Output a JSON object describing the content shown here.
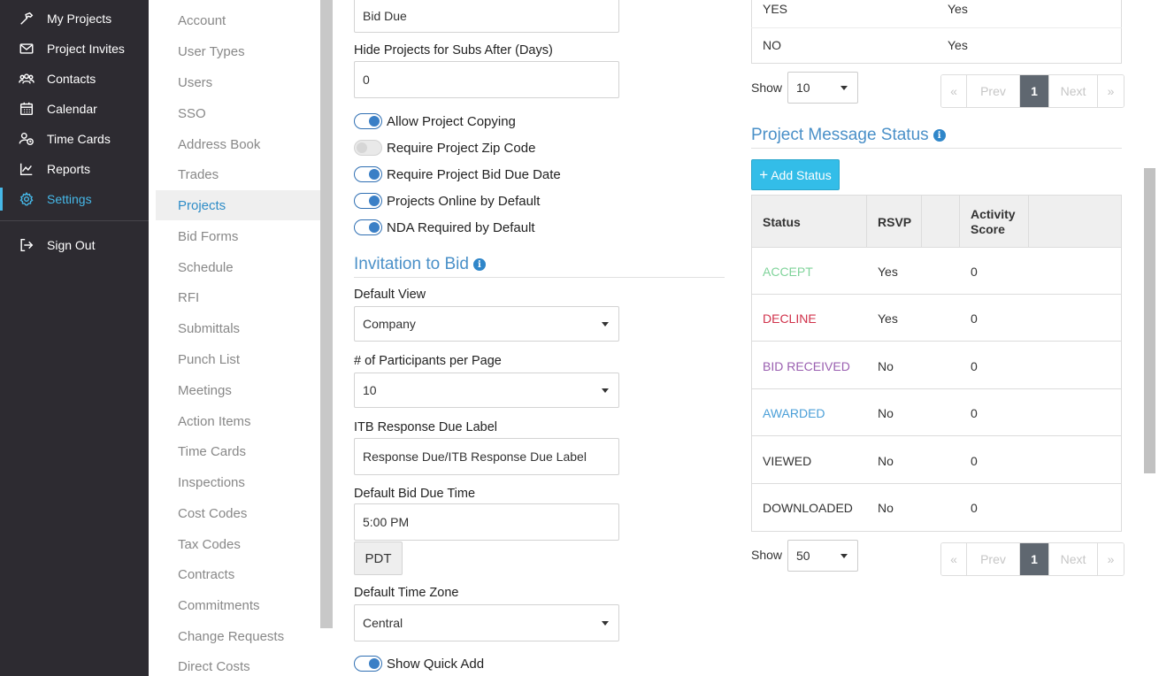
{
  "nav": {
    "items": [
      {
        "label": "My Projects",
        "icon": "hammer-icon"
      },
      {
        "label": "Project Invites",
        "icon": "envelope-icon"
      },
      {
        "label": "Contacts",
        "icon": "people-icon"
      },
      {
        "label": "Calendar",
        "icon": "calendar-icon"
      },
      {
        "label": "Time Cards",
        "icon": "user-clock-icon"
      },
      {
        "label": "Reports",
        "icon": "chart-line-icon"
      },
      {
        "label": "Settings",
        "icon": "gear-icon"
      }
    ],
    "sign_out": {
      "label": "Sign Out",
      "icon": "sign-out-icon"
    },
    "accent": "#46b8e8"
  },
  "submenu": {
    "items": [
      "Account",
      "User Types",
      "Users",
      "SSO",
      "Address Book",
      "Trades",
      "Projects",
      "Bid Forms",
      "Schedule",
      "RFI",
      "Submittals",
      "Punch List",
      "Meetings",
      "Action Items",
      "Time Cards",
      "Inspections",
      "Cost Codes",
      "Tax Codes",
      "Contracts",
      "Commitments",
      "Change Requests",
      "Direct Costs"
    ],
    "active": "Projects"
  },
  "form": {
    "bid_due_value": "Bid Due",
    "hide_projects_label": "Hide Projects for Subs After (Days)",
    "hide_projects_value": "0",
    "toggles": [
      {
        "label": "Allow Project Copying",
        "on": true
      },
      {
        "label": "Require Project Zip Code",
        "on": false
      },
      {
        "label": "Require Project Bid Due Date",
        "on": true
      },
      {
        "label": "Projects Online by Default",
        "on": true
      },
      {
        "label": "NDA Required by Default",
        "on": true
      }
    ],
    "itb_title": "Invitation to Bid",
    "default_view_label": "Default View",
    "default_view_value": "Company",
    "participants_label": "# of Participants per Page",
    "participants_value": "10",
    "itb_response_label": "ITB Response Due Label",
    "itb_response_value": "Response Due/ITB Response Due Label",
    "bid_due_time_label": "Default Bid Due Time",
    "bid_due_time_value": "5:00 PM",
    "tz_button": "PDT",
    "time_zone_label": "Default Time Zone",
    "time_zone_value": "Central",
    "show_quick_add": {
      "label": "Show Quick Add",
      "on": true
    }
  },
  "upper_table": {
    "rows": [
      {
        "status": "YES",
        "value": "Yes"
      },
      {
        "status": "NO",
        "value": "Yes"
      }
    ],
    "show_label": "Show",
    "show_value": "10",
    "pager": {
      "first": "«",
      "prev": "Prev",
      "current": "1",
      "next": "Next",
      "last": "»"
    }
  },
  "message_status": {
    "title": "Project Message Status",
    "add_button": "Add Status",
    "headers": {
      "status": "Status",
      "rsvp": "RSVP",
      "activity": "Activity Score"
    },
    "rows": [
      {
        "status": "ACCEPT",
        "rsvp": "Yes",
        "score": "0",
        "color": "#7fd39a"
      },
      {
        "status": "DECLINE",
        "rsvp": "Yes",
        "score": "0",
        "color": "#d0314a"
      },
      {
        "status": "BID RECEIVED",
        "rsvp": "No",
        "score": "0",
        "color": "#9a5fb0"
      },
      {
        "status": "AWARDED",
        "rsvp": "No",
        "score": "0",
        "color": "#4a9fd8"
      },
      {
        "status": "VIEWED",
        "rsvp": "No",
        "score": "0",
        "color": "#333333"
      },
      {
        "status": "DOWNLOADED",
        "rsvp": "No",
        "score": "0",
        "color": "#333333"
      }
    ],
    "show_label": "Show",
    "show_value": "50",
    "pager": {
      "first": "«",
      "prev": "Prev",
      "current": "1",
      "next": "Next",
      "last": "»"
    }
  }
}
